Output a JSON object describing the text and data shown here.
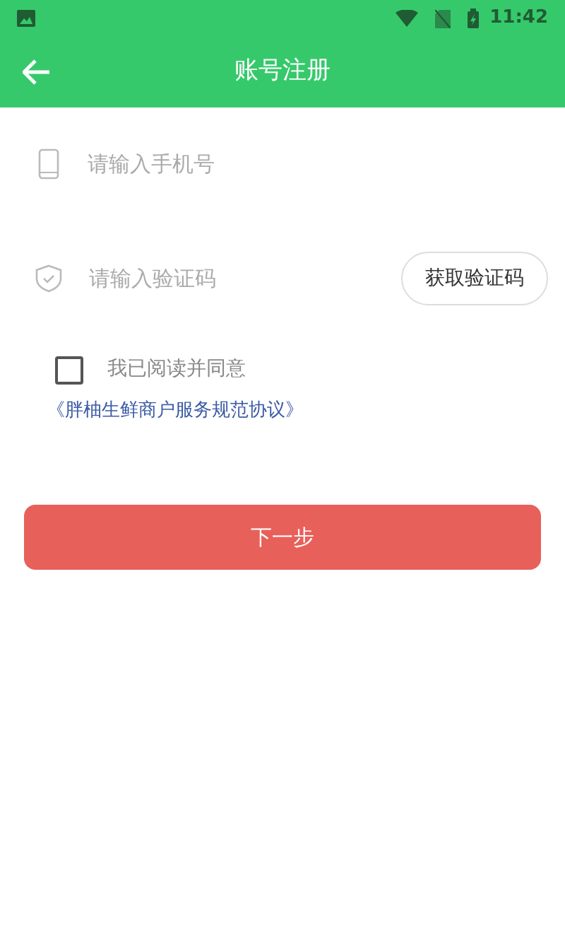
{
  "status_bar": {
    "time": "11:42"
  },
  "header": {
    "title": "账号注册"
  },
  "phone_field": {
    "placeholder": "请输入手机号"
  },
  "code_field": {
    "placeholder": "请输入验证码"
  },
  "get_code_button": {
    "label": "获取验证码"
  },
  "agreement": {
    "checked": false,
    "label": "我已阅读并同意",
    "link": "《胖柚生鲜商户服务规范协议》"
  },
  "next_button": {
    "label": "下一步"
  }
}
